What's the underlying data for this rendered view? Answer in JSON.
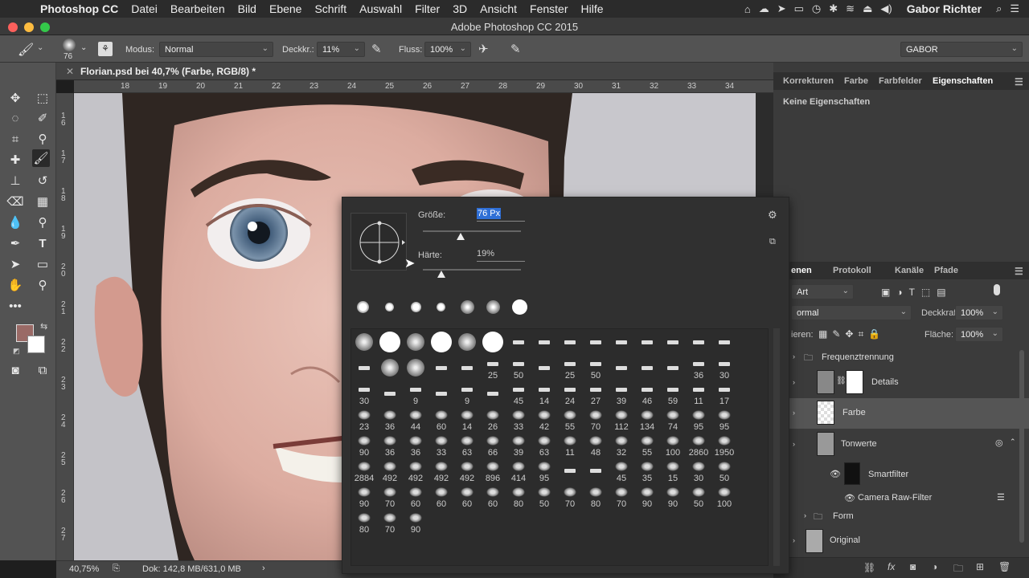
{
  "menubar": {
    "app_name": "Photoshop CC",
    "items": [
      "Datei",
      "Bearbeiten",
      "Bild",
      "Ebene",
      "Schrift",
      "Auswahl",
      "Filter",
      "3D",
      "Ansicht",
      "Fenster",
      "Hilfe"
    ],
    "user": "Gabor Richter"
  },
  "window": {
    "title": "Adobe Photoshop CC 2015"
  },
  "options": {
    "brush_size": "76",
    "mode_label": "Modus:",
    "mode_value": "Normal",
    "opacity_label": "Deckkr.:",
    "opacity_value": "11%",
    "flow_label": "Fluss:",
    "flow_value": "100%",
    "workspace": "GABOR"
  },
  "document": {
    "tab_title": "Florian.psd bei 40,7% (Farbe, RGB/8) *",
    "ruler_h": [
      "18",
      "19",
      "20",
      "21",
      "22",
      "23",
      "24",
      "25",
      "26",
      "27",
      "28",
      "29",
      "30",
      "31",
      "32",
      "33",
      "34"
    ],
    "ruler_v": [
      "1 6",
      "1 7",
      "1 8",
      "1 9",
      "2 0",
      "2 1",
      "2 2",
      "2 3",
      "2 4",
      "2 5",
      "2 6",
      "2 7"
    ]
  },
  "status": {
    "zoom": "40,75%",
    "doc": "Dok: 142,8 MB/631,0 MB"
  },
  "brush_picker": {
    "size_label": "Größe:",
    "size_value": "76 Px",
    "size_level": 0.12,
    "hardness_label": "Härte:",
    "hardness_value": "19%",
    "hardness_level": 0.19,
    "presets": [
      {
        "n": ""
      },
      {
        "n": ""
      },
      {
        "n": ""
      },
      {
        "n": ""
      },
      {
        "n": ""
      },
      {
        "n": ""
      },
      {
        "n": ""
      },
      {
        "n": ""
      },
      {
        "n": ""
      },
      {
        "n": ""
      },
      {
        "n": ""
      },
      {
        "n": ""
      },
      {
        "n": ""
      },
      {
        "n": ""
      },
      {
        "n": ""
      },
      {
        "n": ""
      },
      {
        "n": ""
      },
      {
        "n": ""
      },
      {
        "n": ""
      },
      {
        "n": ""
      },
      {
        "n": "25"
      },
      {
        "n": "50"
      },
      {
        "n": ""
      },
      {
        "n": "25"
      },
      {
        "n": "50"
      },
      {
        "n": ""
      },
      {
        "n": ""
      },
      {
        "n": ""
      },
      {
        "n": "36"
      },
      {
        "n": "30"
      },
      {
        "n": "30"
      },
      {
        "n": ""
      },
      {
        "n": "9"
      },
      {
        "n": ""
      },
      {
        "n": "9"
      },
      {
        "n": ""
      },
      {
        "n": "45"
      },
      {
        "n": "14"
      },
      {
        "n": "24"
      },
      {
        "n": "27"
      },
      {
        "n": "39"
      },
      {
        "n": "46"
      },
      {
        "n": "59"
      },
      {
        "n": "11"
      },
      {
        "n": "17"
      },
      {
        "n": "23"
      },
      {
        "n": "36"
      },
      {
        "n": "44"
      },
      {
        "n": "60"
      },
      {
        "n": "14"
      },
      {
        "n": "26"
      },
      {
        "n": "33"
      },
      {
        "n": "42"
      },
      {
        "n": "55"
      },
      {
        "n": "70"
      },
      {
        "n": "112"
      },
      {
        "n": "134"
      },
      {
        "n": "74"
      },
      {
        "n": "95"
      },
      {
        "n": "95"
      },
      {
        "n": "90"
      },
      {
        "n": "36"
      },
      {
        "n": "36"
      },
      {
        "n": "33"
      },
      {
        "n": "63"
      },
      {
        "n": "66"
      },
      {
        "n": "39"
      },
      {
        "n": "63"
      },
      {
        "n": "11"
      },
      {
        "n": "48"
      },
      {
        "n": "32"
      },
      {
        "n": "55"
      },
      {
        "n": "100"
      },
      {
        "n": "2860"
      },
      {
        "n": "1950"
      },
      {
        "n": "2884"
      },
      {
        "n": "492"
      },
      {
        "n": "492"
      },
      {
        "n": "492"
      },
      {
        "n": "492"
      },
      {
        "n": "896"
      },
      {
        "n": "414"
      },
      {
        "n": "95"
      },
      {
        "n": ""
      },
      {
        "n": ""
      },
      {
        "n": "45"
      },
      {
        "n": "35"
      },
      {
        "n": "15"
      },
      {
        "n": "30"
      },
      {
        "n": "50"
      },
      {
        "n": "90"
      },
      {
        "n": "70"
      },
      {
        "n": "60"
      },
      {
        "n": "60"
      },
      {
        "n": "60"
      },
      {
        "n": "60"
      },
      {
        "n": "80"
      },
      {
        "n": "50"
      },
      {
        "n": "70"
      },
      {
        "n": "80"
      },
      {
        "n": "70"
      },
      {
        "n": "90"
      },
      {
        "n": "90"
      },
      {
        "n": "50"
      },
      {
        "n": "100"
      },
      {
        "n": "80"
      },
      {
        "n": "70"
      },
      {
        "n": "90"
      }
    ]
  },
  "properties": {
    "tabs": [
      "Korrekturen",
      "Farbe",
      "Farbfelder",
      "Eigenschaften"
    ],
    "active_tab": "Eigenschaften",
    "empty_text": "Keine Eigenschaften"
  },
  "layers": {
    "tabs": [
      "enen",
      "Protokoll",
      "Kanäle",
      "Pfade"
    ],
    "filter_kind": "Art",
    "blend": "ormal",
    "opacity_label": "Deckkraft:",
    "opacity_value": "100%",
    "lock_label": "ieren:",
    "fill_label": "Fläche:",
    "fill_value": "100%",
    "items": [
      {
        "name": "Frequenztrennung"
      },
      {
        "name": "Details"
      },
      {
        "name": "Farbe"
      },
      {
        "name": "Tonwerte"
      },
      {
        "name": "Smartfilter"
      },
      {
        "name": "Camera Raw-Filter"
      },
      {
        "name": "Form"
      },
      {
        "name": "Original"
      }
    ]
  },
  "colors": {
    "foreground": "#9a6a66",
    "background": "#ffffff",
    "accent": "#2f6fd6"
  }
}
